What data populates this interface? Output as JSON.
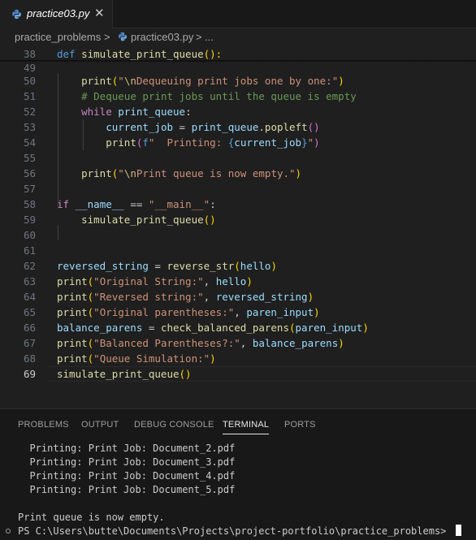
{
  "tab": {
    "title": "practice03.py",
    "icon": "python-file-icon",
    "close_glyph": "✕"
  },
  "breadcrumb": {
    "folder": "practice_problems",
    "sep1": ">",
    "file": "practice03.py",
    "sep2": ">",
    "more": "..."
  },
  "editor": {
    "current_line": "69",
    "lines": [
      {
        "n": "38",
        "tokens": [
          [
            "def",
            "kw"
          ],
          [
            " ",
            ""
          ],
          [
            "simulate_print_queue",
            "fn"
          ],
          [
            "():",
            "b1"
          ]
        ]
      },
      {
        "n": "49",
        "tokens": []
      },
      {
        "n": "50",
        "tokens": [
          [
            "    ",
            ""
          ],
          [
            "print",
            "fn"
          ],
          [
            "(",
            "b1"
          ],
          [
            "\"",
            "str"
          ],
          [
            "\\n",
            "esc"
          ],
          [
            "Dequeuing print jobs one by one:\"",
            "str"
          ],
          [
            ")",
            "b1"
          ]
        ]
      },
      {
        "n": "51",
        "tokens": [
          [
            "    ",
            ""
          ],
          [
            "# Dequeue print jobs until the queue is empty",
            "cmt"
          ]
        ]
      },
      {
        "n": "52",
        "tokens": [
          [
            "    ",
            ""
          ],
          [
            "while",
            "ctrl"
          ],
          [
            " ",
            ""
          ],
          [
            "print_queue",
            "var"
          ],
          [
            ":",
            ""
          ]
        ]
      },
      {
        "n": "53",
        "tokens": [
          [
            "        ",
            ""
          ],
          [
            "current_job",
            "var"
          ],
          [
            " = ",
            ""
          ],
          [
            "print_queue",
            "var"
          ],
          [
            ".",
            ""
          ],
          [
            "popleft",
            "fn"
          ],
          [
            "()",
            "b2"
          ]
        ]
      },
      {
        "n": "54",
        "tokens": [
          [
            "        ",
            ""
          ],
          [
            "print",
            "fn"
          ],
          [
            "(",
            "b2"
          ],
          [
            "f",
            "kw"
          ],
          [
            "\"  Printing: ",
            "str"
          ],
          [
            "{",
            "brace"
          ],
          [
            "current_job",
            "var"
          ],
          [
            "}",
            "brace"
          ],
          [
            "\"",
            "str"
          ],
          [
            ")",
            "b2"
          ]
        ]
      },
      {
        "n": "55",
        "tokens": []
      },
      {
        "n": "56",
        "tokens": [
          [
            "    ",
            ""
          ],
          [
            "print",
            "fn"
          ],
          [
            "(",
            "b1"
          ],
          [
            "\"",
            "str"
          ],
          [
            "\\n",
            "esc"
          ],
          [
            "Print queue is now empty.\"",
            "str"
          ],
          [
            ")",
            "b1"
          ]
        ]
      },
      {
        "n": "57",
        "tokens": []
      },
      {
        "n": "58",
        "tokens": [
          [
            "if",
            "ctrl"
          ],
          [
            " ",
            ""
          ],
          [
            "__name__",
            "var"
          ],
          [
            " == ",
            ""
          ],
          [
            "\"__main__\"",
            "str"
          ],
          [
            ":",
            ""
          ]
        ]
      },
      {
        "n": "59",
        "tokens": [
          [
            "    ",
            ""
          ],
          [
            "simulate_print_queue",
            "fn"
          ],
          [
            "()",
            "b1"
          ]
        ]
      },
      {
        "n": "60",
        "tokens": []
      },
      {
        "n": "61",
        "tokens": []
      },
      {
        "n": "62",
        "tokens": [
          [
            "reversed_string",
            "var"
          ],
          [
            " = ",
            ""
          ],
          [
            "reverse_str",
            "fn"
          ],
          [
            "(",
            "b1"
          ],
          [
            "hello",
            "var"
          ],
          [
            ")",
            "b1"
          ]
        ]
      },
      {
        "n": "63",
        "tokens": [
          [
            "print",
            "fn"
          ],
          [
            "(",
            "b1"
          ],
          [
            "\"Original String:\"",
            "str"
          ],
          [
            ", ",
            ""
          ],
          [
            "hello",
            "var"
          ],
          [
            ")",
            "b1"
          ]
        ]
      },
      {
        "n": "64",
        "tokens": [
          [
            "print",
            "fn"
          ],
          [
            "(",
            "b1"
          ],
          [
            "\"Reversed string:\"",
            "str"
          ],
          [
            ", ",
            ""
          ],
          [
            "reversed_string",
            "var"
          ],
          [
            ")",
            "b1"
          ]
        ]
      },
      {
        "n": "65",
        "tokens": [
          [
            "print",
            "fn"
          ],
          [
            "(",
            "b1"
          ],
          [
            "\"Original parentheses:\"",
            "str"
          ],
          [
            ", ",
            ""
          ],
          [
            "paren_input",
            "var"
          ],
          [
            ")",
            "b1"
          ]
        ]
      },
      {
        "n": "66",
        "tokens": [
          [
            "balance_parens",
            "var"
          ],
          [
            " = ",
            ""
          ],
          [
            "check_balanced_parens",
            "fn"
          ],
          [
            "(",
            "b1"
          ],
          [
            "paren_input",
            "var"
          ],
          [
            ")",
            "b1"
          ]
        ]
      },
      {
        "n": "67",
        "tokens": [
          [
            "print",
            "fn"
          ],
          [
            "(",
            "b1"
          ],
          [
            "\"Balanced Parentheses?:\"",
            "str"
          ],
          [
            ", ",
            ""
          ],
          [
            "balance_parens",
            "var"
          ],
          [
            ")",
            "b1"
          ]
        ]
      },
      {
        "n": "68",
        "tokens": [
          [
            "print",
            "fn"
          ],
          [
            "(",
            "b1"
          ],
          [
            "\"Queue Simulation:\"",
            "str"
          ],
          [
            ")",
            "b1"
          ]
        ]
      },
      {
        "n": "69",
        "tokens": [
          [
            "simulate_print_queue",
            "fn"
          ],
          [
            "()",
            "b1"
          ]
        ]
      }
    ]
  },
  "panel": {
    "tabs": [
      {
        "label": "PROBLEMS",
        "active": false
      },
      {
        "label": "OUTPUT",
        "active": false
      },
      {
        "label": "DEBUG CONSOLE",
        "active": false
      },
      {
        "label": "TERMINAL",
        "active": true
      },
      {
        "label": "PORTS",
        "active": false
      }
    ],
    "terminal_lines": [
      "  Printing: Print Job: Document_2.pdf",
      "  Printing: Print Job: Document_3.pdf",
      "  Printing: Print Job: Document_4.pdf",
      "  Printing: Print Job: Document_5.pdf",
      "",
      "Print queue is now empty."
    ],
    "prompt": "PS C:\\Users\\butte\\Documents\\Projects\\project-portfolio\\practice_problems> "
  },
  "colors": {
    "background": "#1f1f1f",
    "keyword": "#569cd6",
    "control": "#c586c0",
    "function": "#dcdcaa",
    "string": "#ce9178",
    "variable": "#9cdcfe",
    "comment": "#6a9955"
  }
}
